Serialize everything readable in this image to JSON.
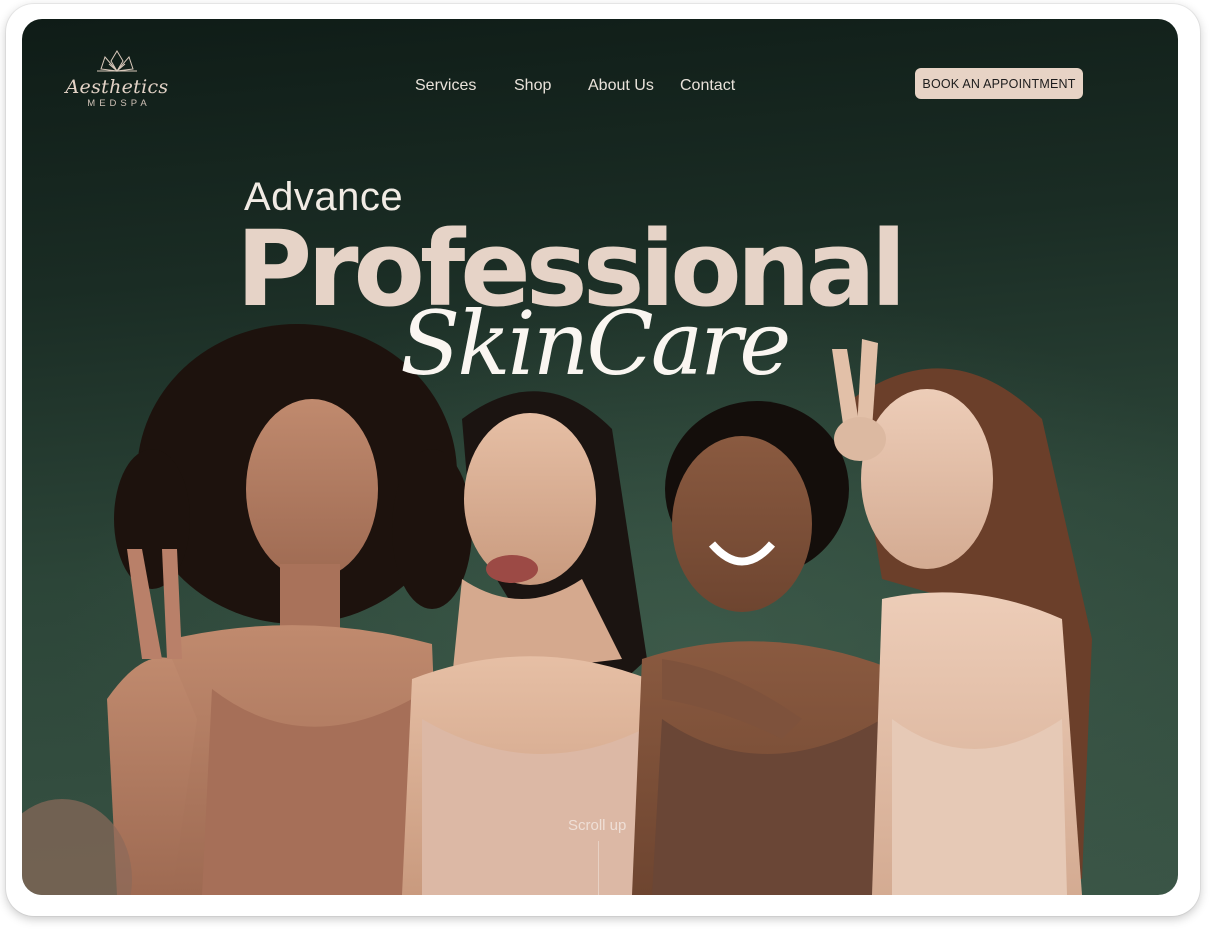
{
  "brand": {
    "name": "Aesthetics",
    "sub": "MEDSPA",
    "icon": "lotus-icon"
  },
  "nav": {
    "items": [
      {
        "label": "Services"
      },
      {
        "label": "Shop"
      },
      {
        "label": "About Us"
      },
      {
        "label": "Contact"
      }
    ],
    "cta_label": "BOOK AN APPOINTMENT"
  },
  "hero": {
    "line1": "Advance",
    "line2": "Professional",
    "line3": "SkinCare",
    "scroll_label": "Scroll up"
  },
  "colors": {
    "bg_dark": "#0f1c17",
    "bg_green": "#3a5546",
    "accent_beige": "#e6d3c7",
    "cta_bg": "#e7d3c5"
  }
}
